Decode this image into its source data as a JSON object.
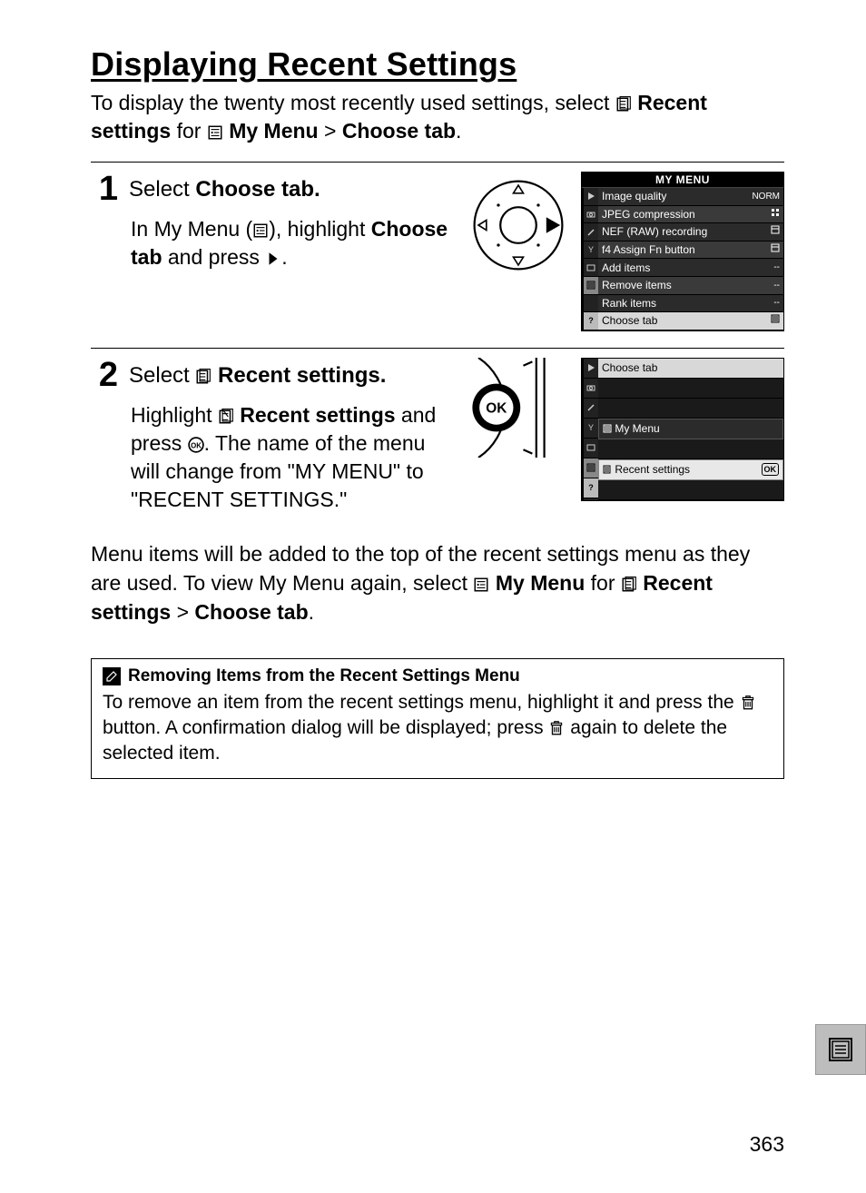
{
  "title": "Displaying Recent Settings",
  "intro": {
    "p1a": "To display the twenty most recently used settings, select ",
    "recent_settings": "Recent settings",
    "p1b": " for ",
    "my_menu": "My Menu",
    "gt": " > ",
    "choose_tab": "Choose tab",
    "period": "."
  },
  "steps": [
    {
      "num": "1",
      "head_a": "Select ",
      "head_b": "Choose tab.",
      "body_a": "In My Menu (",
      "body_b": "), highlight ",
      "body_c": "Choose tab",
      "body_d": " and press ",
      "body_e": "."
    },
    {
      "num": "2",
      "head_a": "Select ",
      "head_b": "Recent settings.",
      "body_a": "Highlight ",
      "body_b": "Recent settings",
      "body_c": " and press ",
      "body_d": ".  The name of the menu will change from \"MY MENU\" to \"RECENT SETTINGS.\""
    }
  ],
  "cam1": {
    "title": "MY MENU",
    "items": [
      {
        "label": "Image quality",
        "val": "NORM"
      },
      {
        "label": "JPEG compression",
        "val": ""
      },
      {
        "label": "NEF (RAW) recording",
        "val": ""
      },
      {
        "label": "f4 Assign Fn button",
        "val": ""
      },
      {
        "label": "Add items",
        "val": "--"
      },
      {
        "label": "Remove items",
        "val": "--"
      },
      {
        "label": "Rank items",
        "val": "--"
      },
      {
        "label": "Choose tab",
        "val": ""
      }
    ]
  },
  "cam2": {
    "title": "Choose tab",
    "my_menu": "My Menu",
    "recent": "Recent settings",
    "ok": "OK"
  },
  "closing": {
    "a": "Menu items will be added to the top of the recent settings menu as they are used.  To view My Menu again, select ",
    "b": "My Menu",
    "c": " for ",
    "d": "Recent settings",
    "e": " > ",
    "f": "Choose tab",
    "g": "."
  },
  "note": {
    "title": "Removing Items from the Recent Settings Menu",
    "body_a": "To remove an item from the recent settings menu, highlight it and press the ",
    "body_b": " button.  A confirmation dialog will be displayed; press ",
    "body_c": " again to delete the selected item."
  },
  "ok_label": "OK",
  "page_number": "363"
}
